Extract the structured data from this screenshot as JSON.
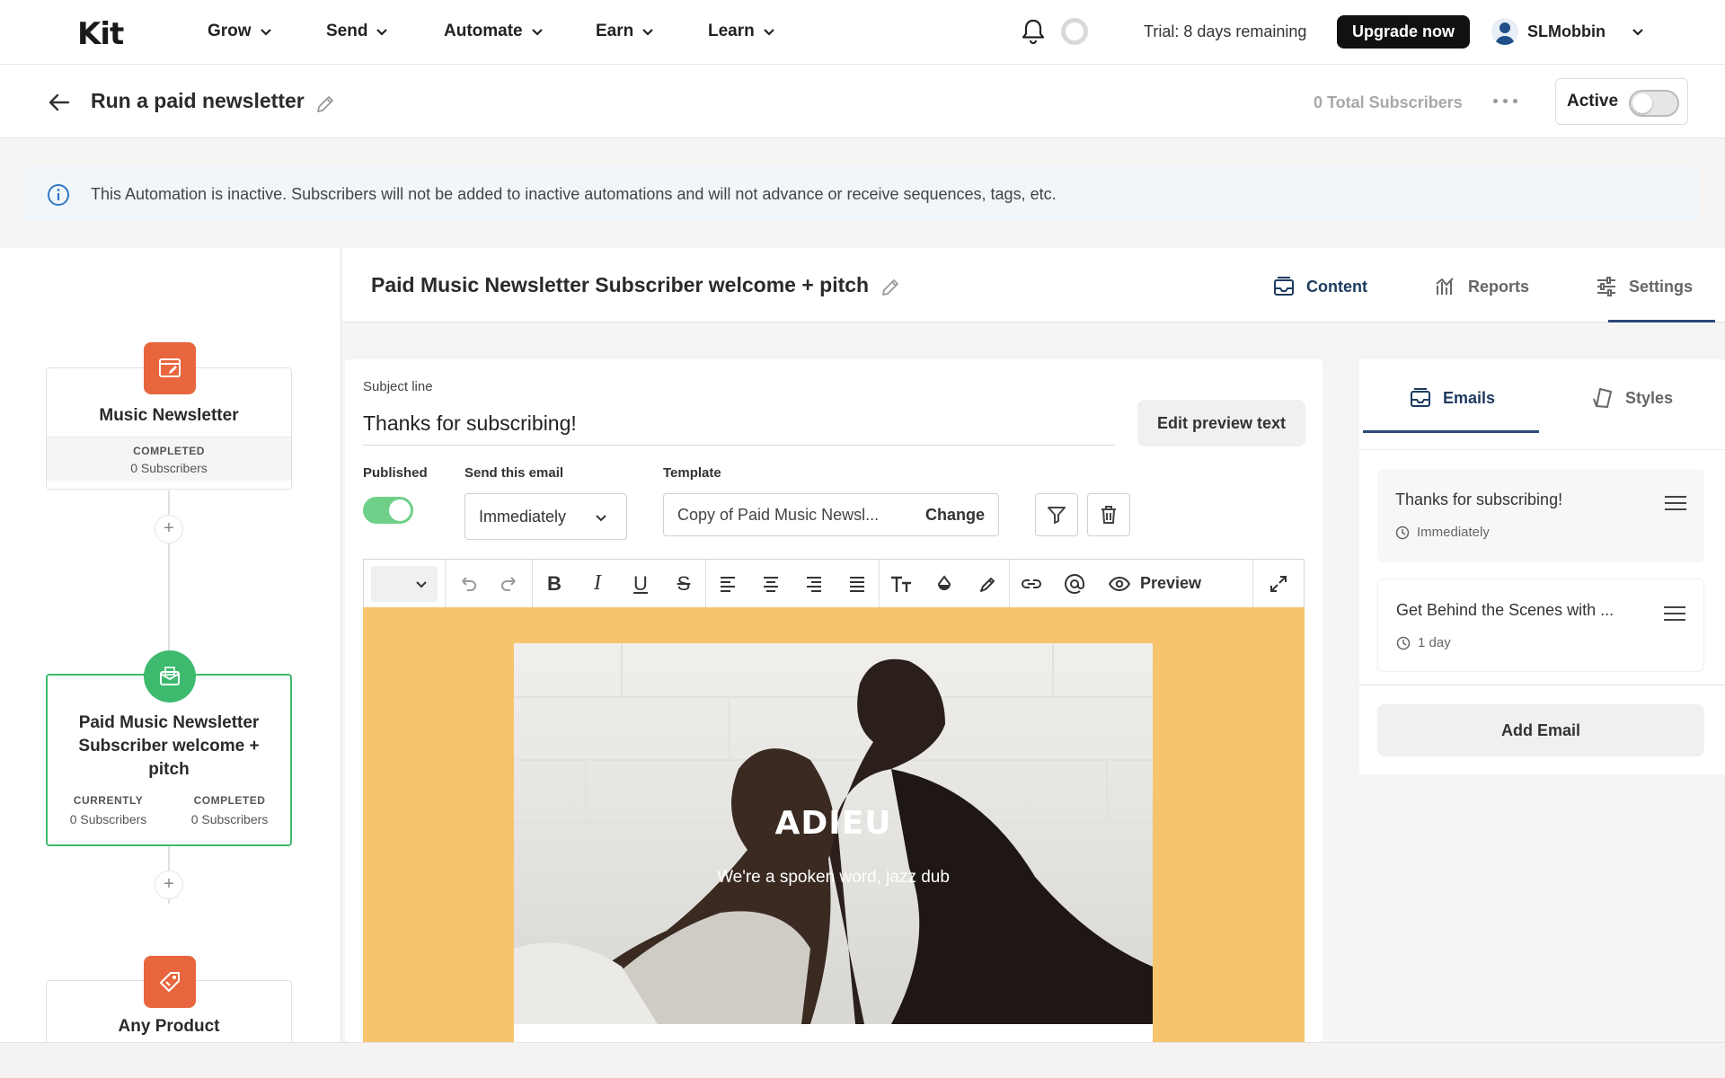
{
  "nav": {
    "logo": "Kit",
    "items": [
      {
        "label": "Grow"
      },
      {
        "label": "Send"
      },
      {
        "label": "Automate"
      },
      {
        "label": "Earn"
      },
      {
        "label": "Learn"
      }
    ],
    "trial": "Trial: 8 days remaining",
    "upgrade": "Upgrade now",
    "username": "SLMobbin"
  },
  "header": {
    "title": "Run a paid newsletter",
    "total_subscribers": "0 Total Subscribers",
    "active_label": "Active",
    "active": false
  },
  "banner": {
    "text": "This Automation is inactive. Subscribers will not be added to inactive automations and will not advance or receive sequences, tags, etc."
  },
  "flow": {
    "node1": {
      "name": "Music Newsletter",
      "stat_label": "COMPLETED",
      "stat_value": "0 Subscribers",
      "color": "#e8663d"
    },
    "node2": {
      "name": "Paid Music Newsletter Subscriber welcome + pitch",
      "stat1_label": "CURRENTLY",
      "stat1_value": "0 Subscribers",
      "stat2_label": "COMPLETED",
      "stat2_value": "0 Subscribers",
      "color": "#3dba6e"
    },
    "node3": {
      "name": "Any Product",
      "color": "#e8663d"
    },
    "plus": "+"
  },
  "main": {
    "title": "Paid Music Newsletter Subscriber welcome + pitch",
    "tabs": [
      {
        "label": "Content",
        "selected": true
      },
      {
        "label": "Reports",
        "selected": false
      },
      {
        "label": "Settings",
        "selected": false
      }
    ]
  },
  "editor": {
    "subject_label": "Subject line",
    "subject_value": "Thanks for subscribing!",
    "preview_text_button": "Edit preview text",
    "published_label": "Published",
    "published": true,
    "send_label": "Send this email",
    "send_value": "Immediately",
    "template_label": "Template",
    "template_value": "Copy of Paid Music Newsl...",
    "template_change": "Change",
    "toolbar": {
      "bold": "B",
      "italic": "I",
      "underline": "U",
      "strike": "S",
      "preview": "Preview"
    },
    "hero_title": "ADIEU",
    "hero_subtitle": "We're a spoken word, jazz dub",
    "canvas_color": "#f6c46c"
  },
  "right": {
    "tabs": [
      {
        "label": "Emails",
        "selected": true
      },
      {
        "label": "Styles",
        "selected": false
      }
    ],
    "emails": [
      {
        "title": "Thanks for subscribing!",
        "delay": "Immediately"
      },
      {
        "title": "Get Behind the Scenes with ...",
        "delay": "1 day"
      }
    ],
    "add_email": "Add Email"
  }
}
